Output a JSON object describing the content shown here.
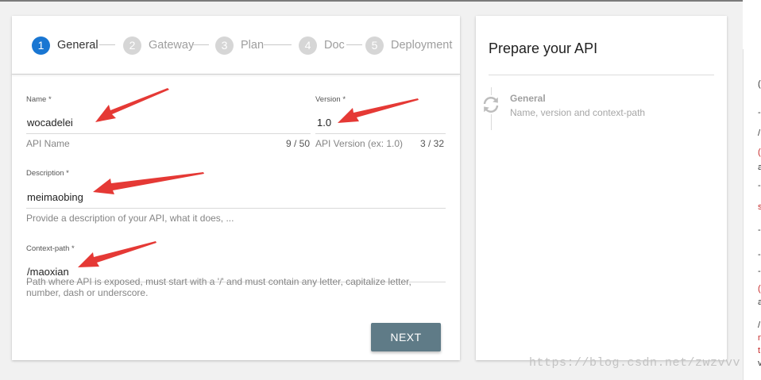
{
  "stepper": {
    "steps": [
      {
        "number": "1",
        "label": "General",
        "active": true
      },
      {
        "number": "2",
        "label": "Gateway",
        "active": false
      },
      {
        "number": "3",
        "label": "Plan",
        "active": false
      },
      {
        "number": "4",
        "label": "Doc",
        "active": false
      },
      {
        "number": "5",
        "label": "Deployment",
        "active": false
      }
    ]
  },
  "form": {
    "name": {
      "label": "Name *",
      "value": "wocadelei",
      "hint": "API Name",
      "counter": "9 / 50"
    },
    "version": {
      "label": "Version *",
      "value": "1.0",
      "hint": "API Version (ex: 1.0)",
      "counter": "3 / 32"
    },
    "description": {
      "label": "Description *",
      "value": "meimaobing",
      "hint": "Provide a description of your API, what it does, ..."
    },
    "context_path": {
      "label": "Context-path *",
      "value": "/maoxian",
      "hint_line1": "Path where API is exposed, must start with a '/' and must contain any letter, capitalize letter,",
      "hint_line2": "number, dash or underscore."
    },
    "next_label": "NEXT"
  },
  "side_panel": {
    "title": "Prepare your API",
    "step_title": "General",
    "step_subtitle": "Name, version and context-path"
  },
  "right_strip_glyphs": [
    "(",
    "-",
    "/",
    "(",
    "a",
    "-",
    "s",
    "-",
    "-",
    "-",
    "(",
    "a",
    "/",
    "n",
    "t",
    "v"
  ],
  "watermark": "https://blog.csdn.net/zwzvvv",
  "colors": {
    "accent": "#1976d2",
    "next_button": "#5f7b87",
    "annotation_arrow": "#e53935"
  },
  "icons": {
    "side_step": "sync-icon"
  }
}
